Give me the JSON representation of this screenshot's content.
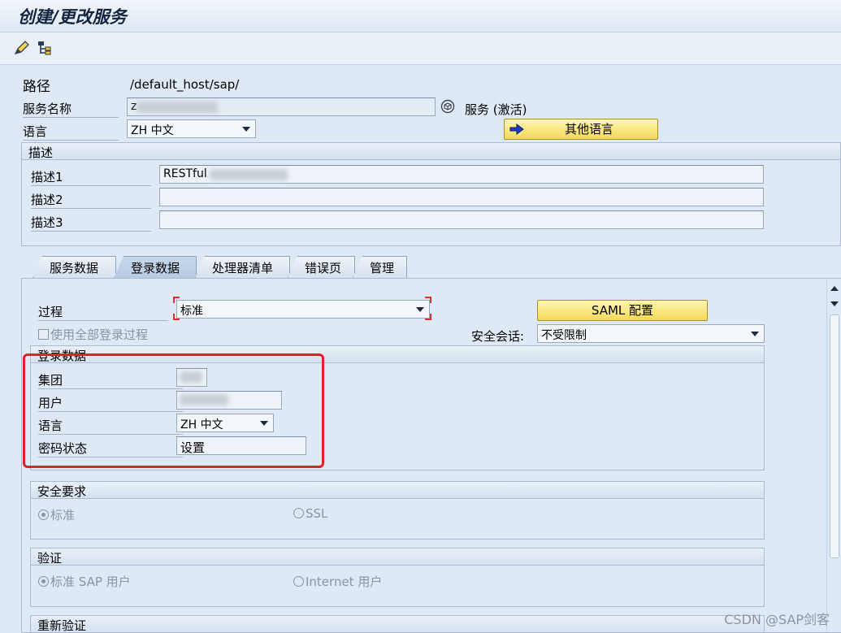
{
  "window": {
    "title": "创建/更改服务"
  },
  "toolbar": {
    "icons": [
      "edit-icon",
      "hierarchy-icon"
    ]
  },
  "header": {
    "path_label": "路径",
    "path_value": "/default_host/sap/",
    "service_name_label": "服务名称",
    "service_name_value": "z",
    "service_status": "服务 (激活)",
    "language_label": "语言",
    "language_value": "ZH 中文",
    "other_languages_button": "其他语言"
  },
  "description": {
    "group_title": "描述",
    "rows": [
      {
        "label": "描述1",
        "value": "RESTful"
      },
      {
        "label": "描述2",
        "value": ""
      },
      {
        "label": "描述3",
        "value": ""
      }
    ]
  },
  "tabs": [
    {
      "label": "服务数据",
      "active": false
    },
    {
      "label": "登录数据",
      "active": true
    },
    {
      "label": "处理器清单",
      "active": false
    },
    {
      "label": "错误页",
      "active": false
    },
    {
      "label": "管理",
      "active": false
    }
  ],
  "logon": {
    "procedure_label": "过程",
    "procedure_value": "标准",
    "saml_button": "SAML 配置",
    "use_all_procedures": "使用全部登录过程",
    "secure_session_label": "安全会话:",
    "secure_session_value": "不受限制",
    "logon_data_group": "登录数据",
    "client_label": "集团",
    "user_label": "用户",
    "language_label": "语言",
    "language_value": "ZH 中文",
    "password_status_label": "密码状态",
    "password_status_value": "设置"
  },
  "security": {
    "group_title": "安全要求",
    "options": [
      {
        "label": "标准",
        "selected": true
      },
      {
        "label": "SSL",
        "selected": false
      }
    ]
  },
  "auth": {
    "group_title": "验证",
    "options": [
      {
        "label": "标准 SAP 用户",
        "selected": true
      },
      {
        "label": "Internet 用户",
        "selected": false
      }
    ]
  },
  "reauth": {
    "group_title": "重新验证"
  },
  "watermark": "CSDN @SAP剑客"
}
